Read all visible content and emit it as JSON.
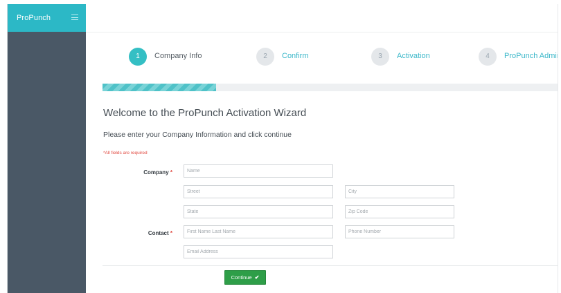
{
  "app": {
    "brand": "ProPunch"
  },
  "wizard": {
    "steps": [
      {
        "num": "1",
        "label": "Company Info",
        "active": true
      },
      {
        "num": "2",
        "label": "Confirm",
        "active": false
      },
      {
        "num": "3",
        "label": "Activation",
        "active": false
      },
      {
        "num": "4",
        "label": "ProPunch Admin",
        "active": false
      }
    ],
    "progress_fraction": 0.25
  },
  "form": {
    "title": "Welcome to the ProPunch Activation Wizard",
    "instructions": "Please enter your Company Information and click continue",
    "required_note": "*All fields are required",
    "company_label": "Company",
    "contact_label": "Contact",
    "required_mark": "*",
    "placeholders": {
      "name": "Name",
      "street": "Street",
      "city": "City",
      "state": "State",
      "zip": "Zip Code",
      "contact_name": "First Name Last Name",
      "phone": "Phone Number",
      "email": "Email Address"
    },
    "continue_label": "Continue",
    "continue_icon": "✔"
  },
  "colors": {
    "brand": "#2cb8c6",
    "sidebar": "#4a5866",
    "active_step": "#34bfc4",
    "link": "#3ab7c9",
    "required": "#e0453c",
    "continue": "#2e9e48"
  }
}
